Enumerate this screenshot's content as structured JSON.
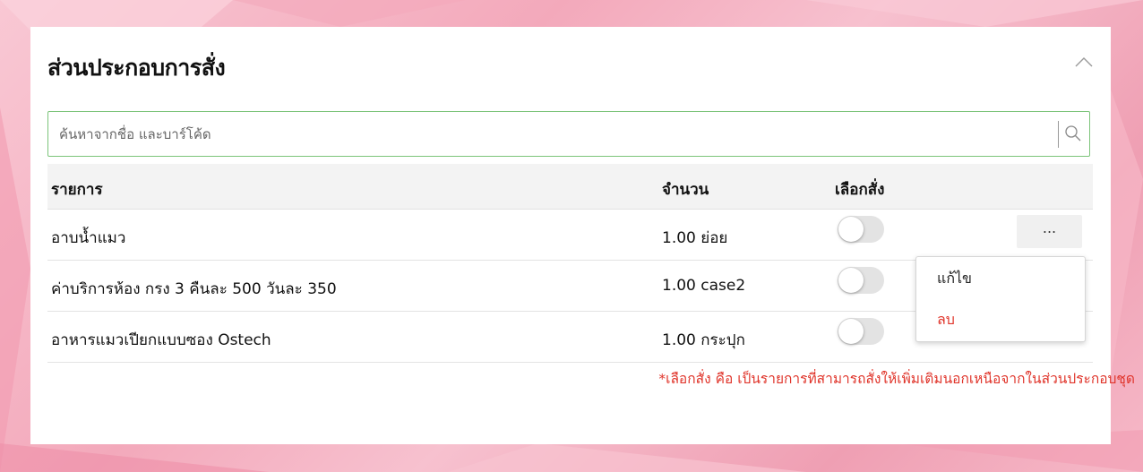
{
  "panel": {
    "title": "ส่วนประกอบการสั่ง",
    "collapse_icon": "chevron-up-icon"
  },
  "search": {
    "placeholder": "ค้นหาจากชื่อ และบาร์โค้ด",
    "value": "",
    "icon": "search-icon"
  },
  "table": {
    "columns": [
      "รายการ",
      "จำนวน",
      "เลือกสั่ง"
    ],
    "rows": [
      {
        "name": "อาบน้ำแมว",
        "qty": "1.00 ย่อย",
        "optional": false
      },
      {
        "name": "ค่าบริการห้อง กรง 3 คืนละ 500 วันละ 350",
        "qty": "1.00 case2",
        "optional": false
      },
      {
        "name": "อาหารแมวเปียกแบบซอง Ostech",
        "qty": "1.00 กระปุก",
        "optional": false
      }
    ],
    "more_label": "..."
  },
  "context_menu": {
    "edit_label": "แก้ไข",
    "delete_label": "ลบ"
  },
  "footnote": "*เลือกสั่ง คือ เป็นรายการที่สามารถสั่งให้เพิ่มเติมนอกเหนือจากในส่วนประกอบชุด",
  "colors": {
    "accent_green": "#7cc47a",
    "danger_red": "#e0352b",
    "toggle_off": "#e3e3e3"
  }
}
